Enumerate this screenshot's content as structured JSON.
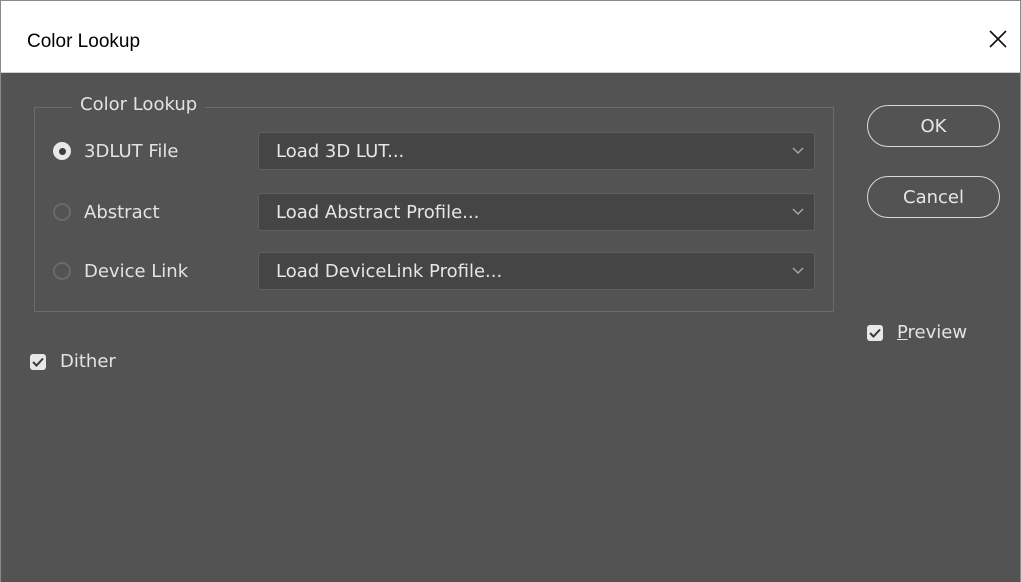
{
  "window": {
    "title": "Color Lookup"
  },
  "group": {
    "legend": "Color Lookup",
    "rows": [
      {
        "label": "3DLUT File",
        "selected": true,
        "select_value": "Load 3D LUT..."
      },
      {
        "label": "Abstract",
        "selected": false,
        "select_value": "Load Abstract Profile..."
      },
      {
        "label": "Device Link",
        "selected": false,
        "select_value": "Load DeviceLink Profile..."
      }
    ]
  },
  "buttons": {
    "ok": "OK",
    "cancel": "Cancel"
  },
  "checkboxes": {
    "preview": {
      "label": "Preview",
      "checked": true
    },
    "dither": {
      "label": "Dither",
      "checked": true
    }
  },
  "icons": {
    "close": "close-icon",
    "dropdown": "chevron-down-icon",
    "check": "checkmark-icon"
  },
  "colors": {
    "panel": "#535353",
    "field": "#454545",
    "text": "#e3e3e3",
    "titlebar": "#ffffff"
  }
}
